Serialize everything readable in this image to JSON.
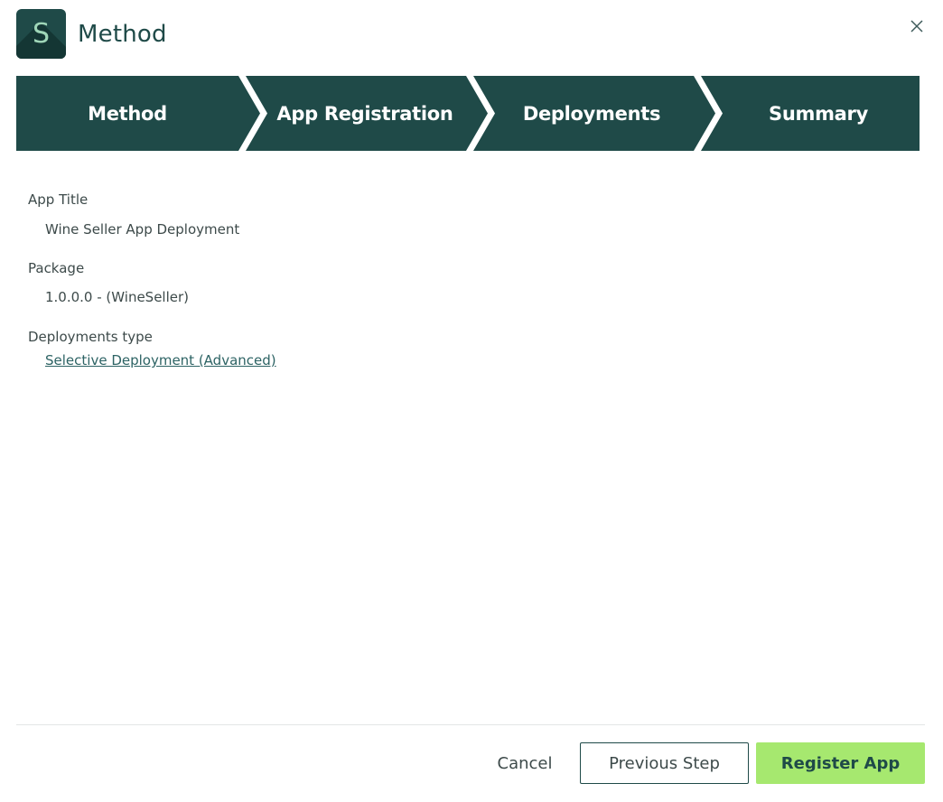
{
  "header": {
    "logo_letter": "S",
    "title": "Method",
    "close_icon": "close-icon"
  },
  "stepper": {
    "steps": [
      {
        "label": "Method"
      },
      {
        "label": "App Registration"
      },
      {
        "label": "Deployments"
      },
      {
        "label": "Summary"
      }
    ],
    "color": "#1f4a48"
  },
  "summary": {
    "app_title_label": "App Title",
    "app_title_value": "Wine Seller App Deployment",
    "package_label": "Package",
    "package_value": "1.0.0.0 - (WineSeller)",
    "deployments_type_label": "Deployments type",
    "deployments_type_value": "Selective Deployment (Advanced)"
  },
  "footer": {
    "cancel_label": "Cancel",
    "previous_label": "Previous Step",
    "register_label": "Register App"
  },
  "colors": {
    "primary": "#1f4a48",
    "accent": "#a6e86f",
    "link": "#2d6364"
  }
}
